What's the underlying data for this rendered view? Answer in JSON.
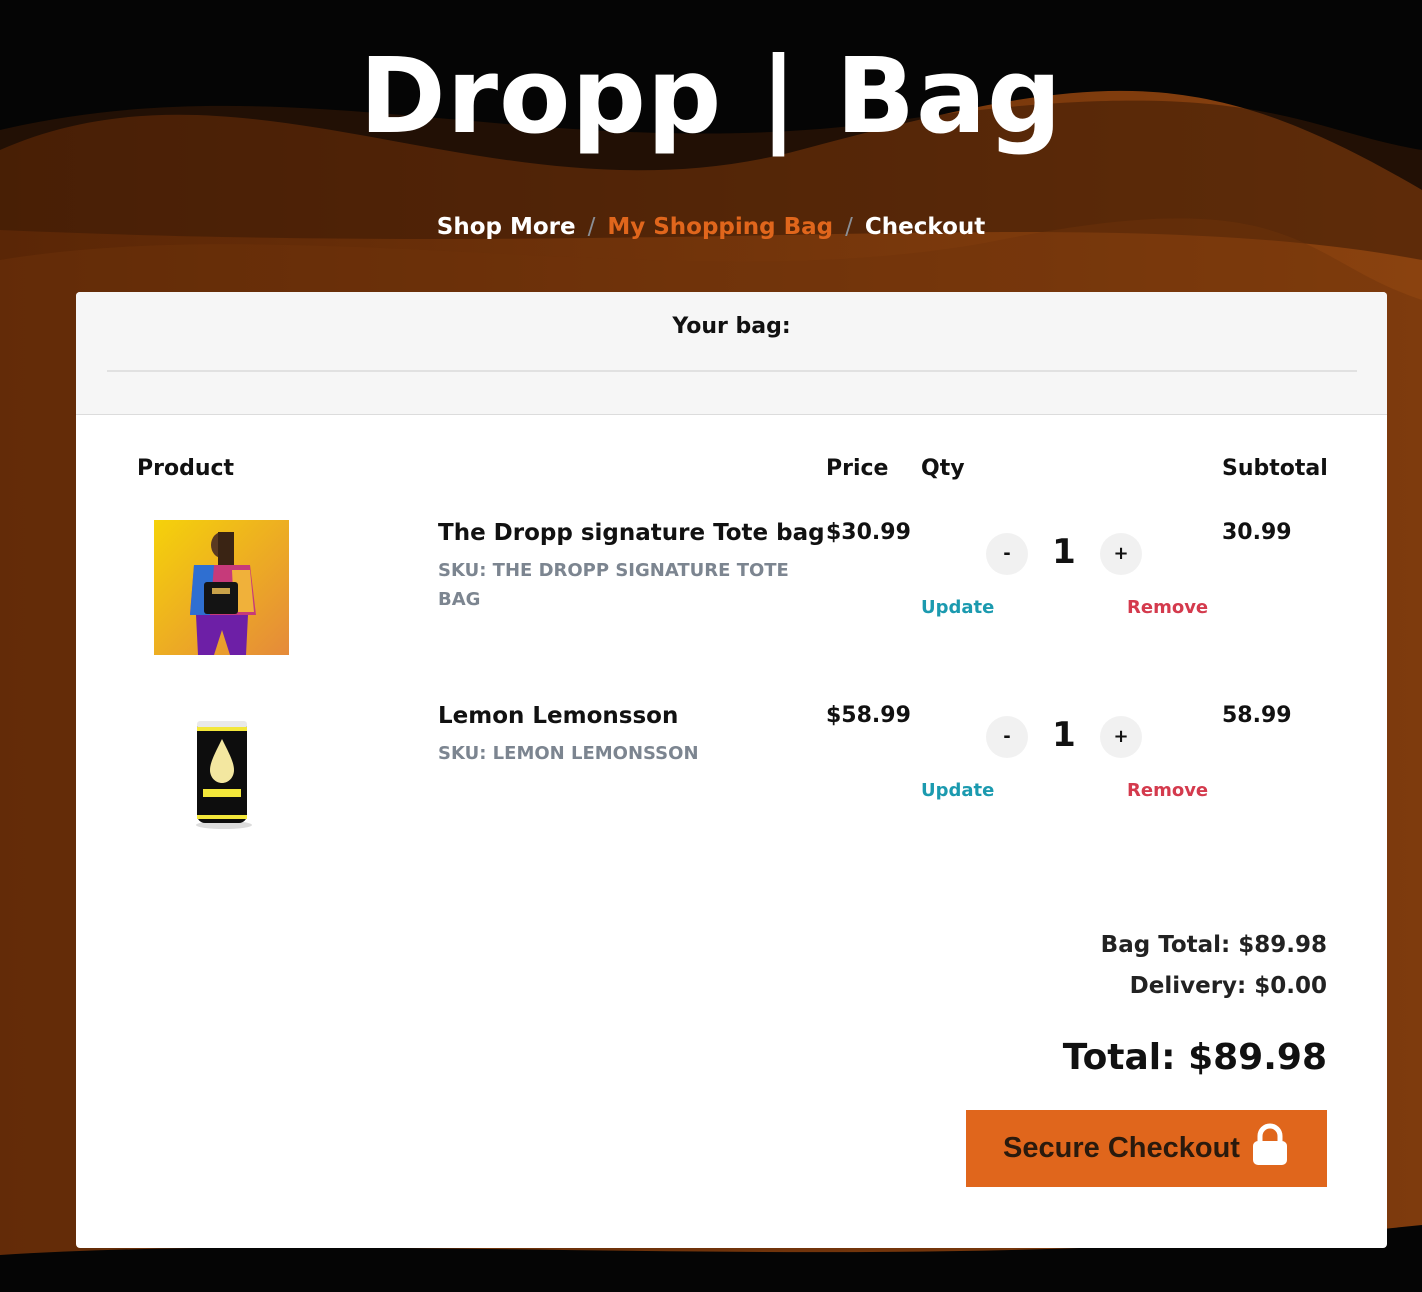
{
  "header": {
    "title": "Dropp | Bag"
  },
  "breadcrumb": {
    "items": [
      "Shop More",
      "My Shopping Bag",
      "Checkout"
    ],
    "separator": "/"
  },
  "bag": {
    "heading": "Your bag:",
    "columns": {
      "product": "Product",
      "price": "Price",
      "qty": "Qty",
      "subtotal": "Subtotal"
    },
    "items": [
      {
        "name": "The Dropp signature Tote bag",
        "sku": "SKU: THE DROPP SIGNATURE TOTE BAG",
        "price": "$30.99",
        "qty": "1",
        "subtotal": "30.99",
        "decrement": "-",
        "increment": "+",
        "update": "Update",
        "remove": "Remove"
      },
      {
        "name": "Lemon Lemonsson",
        "sku": "SKU: LEMON LEMONSSON",
        "price": "$58.99",
        "qty": "1",
        "subtotal": "58.99",
        "decrement": "-",
        "increment": "+",
        "update": "Update",
        "remove": "Remove"
      }
    ],
    "bag_total": "Bag Total: $89.98",
    "delivery": "Delivery: $0.00",
    "total": "Total: $89.98",
    "checkout_label": "Secure Checkout"
  },
  "colors": {
    "accent": "#e0661c",
    "update": "#1b9aaf",
    "remove": "#d43a4d",
    "background": "#050505"
  },
  "icons": {
    "checkout": "lock-icon"
  }
}
